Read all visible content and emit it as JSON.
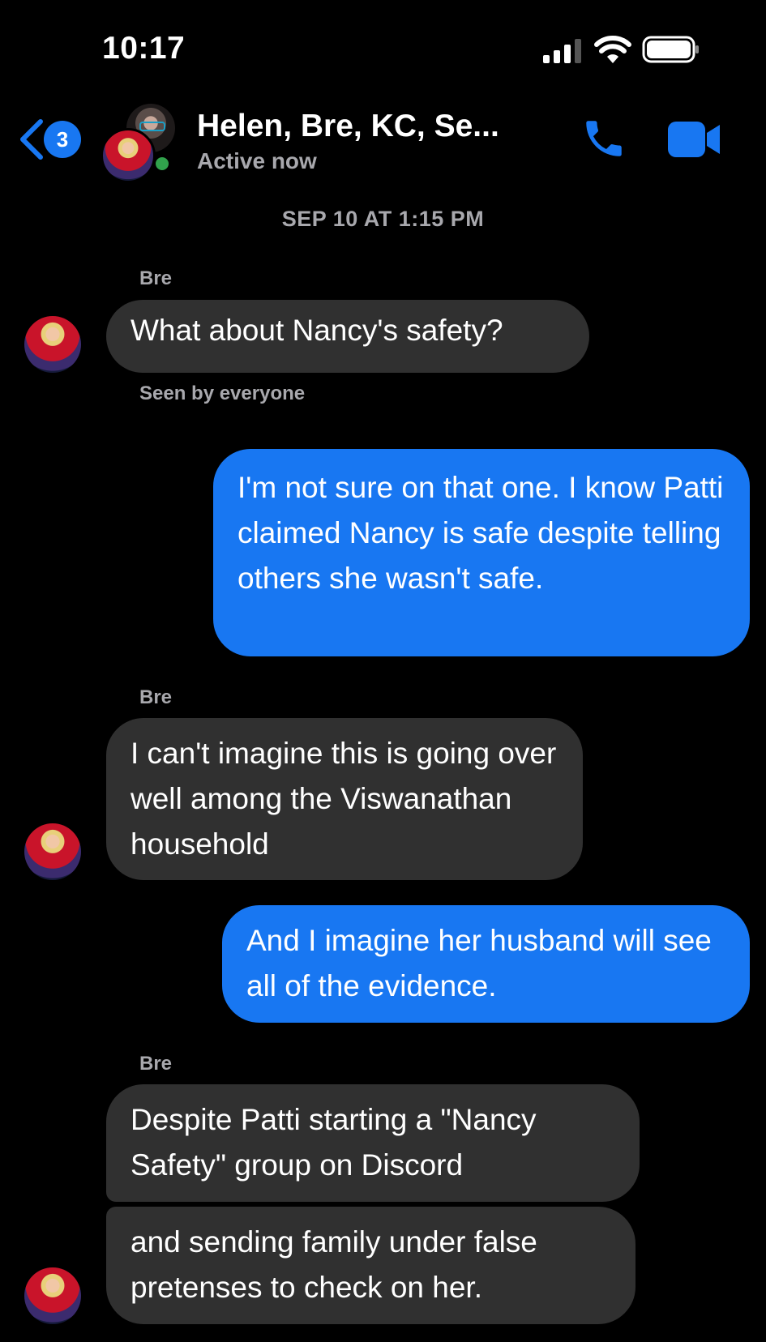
{
  "status_bar": {
    "time": "10:17"
  },
  "header": {
    "back_badge": "3",
    "title": "Helen, Bre, KC, Se...",
    "subtitle": "Active now"
  },
  "chat": {
    "timestamp": "SEP 10 AT 1:15 PM",
    "messages": [
      {
        "sender": "Bre",
        "direction": "incoming",
        "text": "What about Nancy's safety?"
      },
      {
        "receipt": "Seen by everyone"
      },
      {
        "direction": "outgoing",
        "text": "I'm not sure on that one. I know Patti claimed Nancy is safe despite telling others she wasn't safe."
      },
      {
        "sender": "Bre",
        "direction": "incoming",
        "text": "I can't imagine this is going over well among the Viswanathan household"
      },
      {
        "direction": "outgoing",
        "text": "And I imagine her husband will see all of the evidence."
      },
      {
        "sender": "Bre",
        "direction": "incoming",
        "text": "Despite Patti starting a \"Nancy Safety\" group on Discord"
      },
      {
        "direction": "incoming",
        "text": "and sending family under false pretenses to check on her."
      }
    ]
  },
  "colors": {
    "background": "#000000",
    "incoming_bubble": "#303030",
    "outgoing_bubble": "#1877f2",
    "accent": "#1877f2",
    "online": "#31a24c"
  },
  "icons": {
    "back": "chevron-left-icon",
    "call": "phone-icon",
    "video": "video-camera-icon"
  }
}
